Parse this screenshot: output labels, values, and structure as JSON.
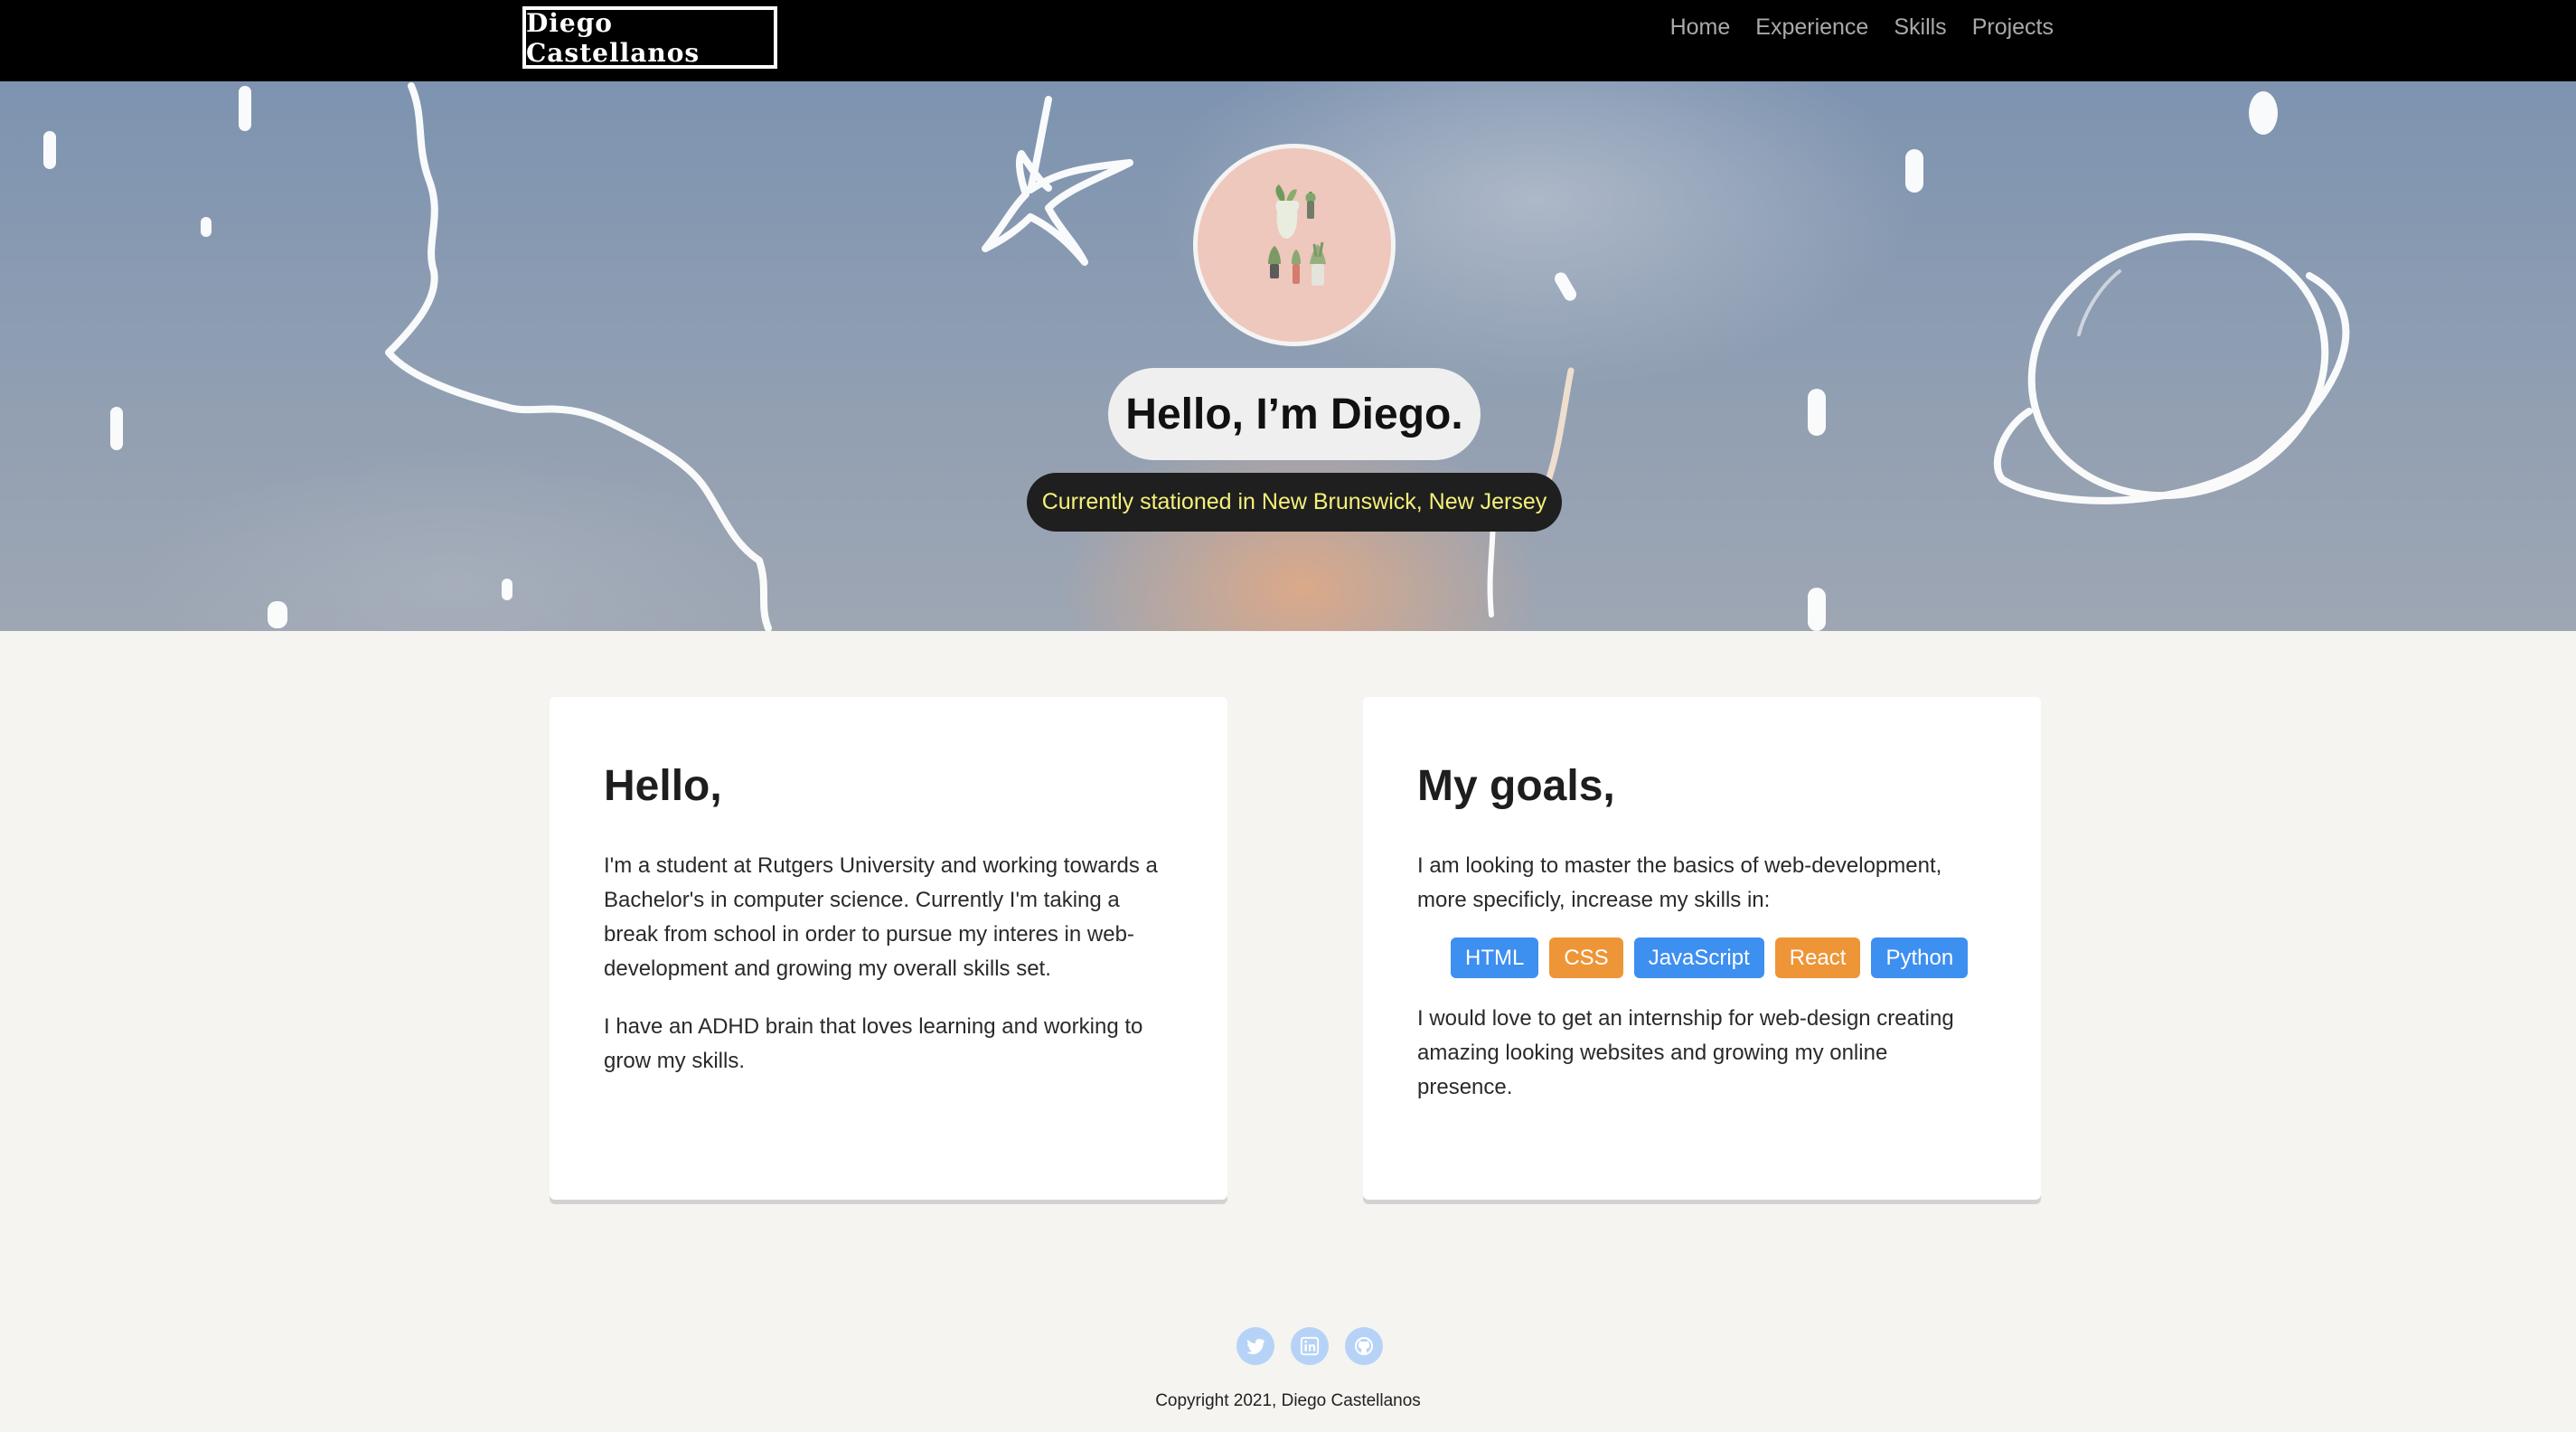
{
  "nav": {
    "brand": "Diego Castellanos",
    "links": [
      "Home",
      "Experience",
      "Skills",
      "Projects"
    ]
  },
  "hero": {
    "avatar_icon": "potted-plants-icon",
    "title": "Hello, I’m Diego.",
    "subtitle": "Currently stationed in New Brunswick, New Jersey"
  },
  "about": {
    "heading": "Hello,",
    "paragraphs": [
      "I'm a student at Rutgers University and working towards a Bachelor's in computer science. Currently I'm taking a break from school in order to pursue my interes in web-development and growing my overall skills set.",
      "I have an ADHD brain that loves learning and working to grow my skills."
    ]
  },
  "goals": {
    "heading": "My goals,",
    "intro": "I am looking to master the basics of web-development, more specificly, increase my skills in:",
    "skills": [
      {
        "label": "HTML",
        "color": "#3d8ff0"
      },
      {
        "label": "CSS",
        "color": "#ee9537"
      },
      {
        "label": "JavaScript",
        "color": "#3d8ff0"
      },
      {
        "label": "React",
        "color": "#ee9537"
      },
      {
        "label": "Python",
        "color": "#3d8ff0"
      }
    ],
    "outro": "I would love to get an internship for web-design creating amazing looking websites and growing my online presence."
  },
  "footer": {
    "socials": [
      "twitter-icon",
      "linkedin-icon",
      "github-icon"
    ],
    "copyright": "Copyright 2021, Diego Castellanos"
  },
  "colors": {
    "navbar": "#000000",
    "page_background": "#f5f4f0",
    "subtitle_text": "#f5f07a",
    "social_icon": "#b6d3f7"
  }
}
